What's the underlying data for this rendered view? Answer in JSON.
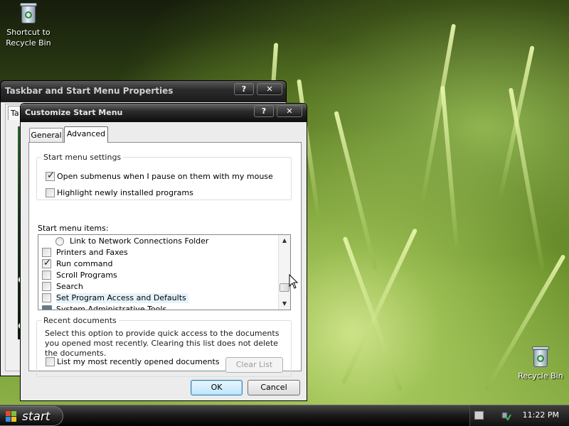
{
  "desktop": {
    "icons": [
      {
        "label_line1": "Shortcut to",
        "label_line2": "Recycle Bin"
      },
      {
        "label_line1": "Recycle Bin",
        "label_line2": ""
      }
    ]
  },
  "back_window": {
    "title": "Taskbar and Start Menu Properties",
    "tab_label": "Ta",
    "help_glyph": "?",
    "close_glyph": "✕"
  },
  "dialog": {
    "title": "Customize Start Menu",
    "help_glyph": "?",
    "close_glyph": "✕",
    "tabs": [
      {
        "label": "General",
        "active": false
      },
      {
        "label": "Advanced",
        "active": true
      }
    ],
    "start_menu_settings": {
      "title": "Start menu settings",
      "options": [
        {
          "label": "Open submenus when I pause on them with my mouse",
          "checked": true
        },
        {
          "label": "Highlight newly installed programs",
          "checked": false
        }
      ]
    },
    "start_menu_items": {
      "title": "Start menu items:",
      "items": [
        {
          "label": "Link to Network Connections Folder",
          "type": "radio",
          "checked": false
        },
        {
          "label": "Printers and Faxes",
          "type": "checkbox",
          "checked": false
        },
        {
          "label": "Run command",
          "type": "checkbox",
          "checked": true
        },
        {
          "label": "Scroll Programs",
          "type": "checkbox",
          "checked": false
        },
        {
          "label": "Search",
          "type": "checkbox",
          "checked": false
        },
        {
          "label": "Set Program Access and Defaults",
          "type": "checkbox",
          "checked": false
        },
        {
          "label": "System Administrative Tools",
          "type": "folder",
          "checked": false
        }
      ]
    },
    "recent_documents": {
      "title": "Recent documents",
      "description": "Select this option to provide quick access to the documents you opened most recently.  Clearing this list does not delete the documents.",
      "option_label": "List my most recently opened documents",
      "option_checked": false,
      "clear_button": "Clear List"
    },
    "ok_button": "OK",
    "cancel_button": "Cancel"
  },
  "taskbar": {
    "start_label": "start",
    "clock": "11:22 PM"
  },
  "colors": {
    "accent": "#3c7fb1",
    "taskbar": "#1c1c1c",
    "dialog_bg": "#ececec"
  }
}
